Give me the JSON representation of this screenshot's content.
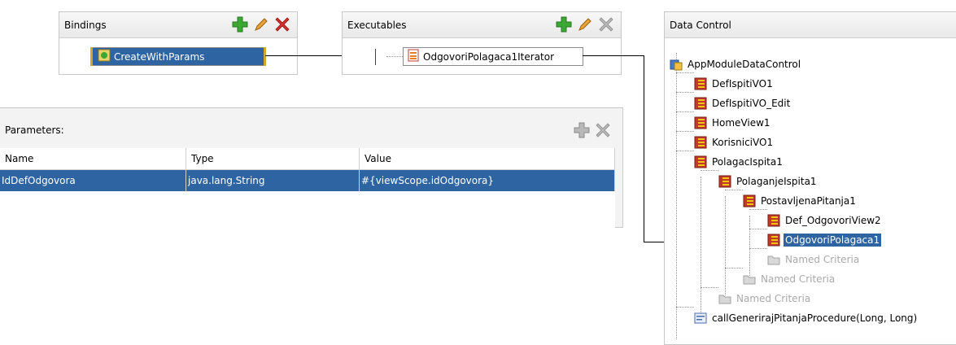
{
  "bindings": {
    "title": "Bindings",
    "item": "CreateWithParams"
  },
  "executables": {
    "title": "Executables",
    "item": "OdgovoriPolagaca1Iterator"
  },
  "parameters": {
    "title": "Parameters:",
    "columns": [
      "Name",
      "Type",
      "Value"
    ],
    "rows": [
      {
        "name": "IdDefOdgovora",
        "type": "java.lang.String",
        "value": "#{viewScope.idOdgovora}"
      }
    ]
  },
  "data_control": {
    "title": "Data Control",
    "nodes": [
      "AppModuleDataControl",
      "DefIspitiVO1",
      "DefIspitiVO_Edit",
      "HomeView1",
      "KorisniciVO1",
      "PolagacIspita1",
      "PolaganjeIspita1",
      "PostavljenaPitanja1",
      "Def_OdgovoriView2",
      "OdgovoriPolagaca1",
      "Named Criteria",
      "Named Criteria",
      "Named Criteria",
      "callGenerirajPitanjaProcedure(Long, Long)"
    ]
  },
  "colors": {
    "selection": "#2e64a2",
    "add": "#3aa832",
    "delete": "#d62f2f",
    "disabled": "#a9a9a9"
  },
  "icons": [
    "add-icon",
    "edit-icon",
    "delete-icon",
    "data-control-icon",
    "view-object-icon",
    "folder-icon",
    "method-icon",
    "iterator-icon",
    "action-icon"
  ]
}
